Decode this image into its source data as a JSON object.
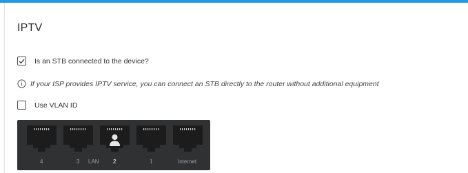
{
  "title": "IPTV",
  "stb_checkbox": {
    "checked": true,
    "label": "Is an STB connected to the device?"
  },
  "info": {
    "icon": "info-icon",
    "text": "If your ISP provides IPTV service, you can connect an STB directly to the router without additional equipment"
  },
  "vlan_checkbox": {
    "checked": false,
    "label": "Use VLAN ID"
  },
  "ports": [
    {
      "label": "4"
    },
    {
      "label": "3"
    },
    {
      "label": "2",
      "assigned_device": "stb-user-icon"
    },
    {
      "label": "1"
    },
    {
      "label": "Internet"
    }
  ],
  "lan_group_label": "LAN",
  "colors": {
    "accent": "#1f9bde",
    "panel": "#2f3133",
    "port": "#1c1c1c",
    "inactive_label": "#9aa0a5"
  }
}
